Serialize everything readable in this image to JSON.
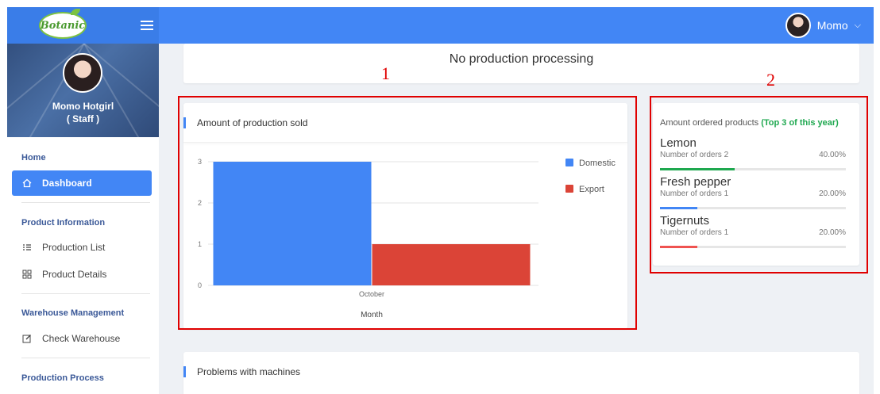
{
  "colors": {
    "topbar": "#4286f5",
    "accent": "#4286f5",
    "domestic": "#4286f5",
    "export": "#db4437",
    "green": "#1ea84f",
    "annotation_red": "#e00000"
  },
  "header": {
    "logo_text": "Botanic",
    "user_name": "Momo",
    "menu_icon": "hamburger-icon",
    "chevron_icon": "chevron-down-icon"
  },
  "sidebar": {
    "profile_name": "Momo Hotgirl",
    "profile_role": "( Staff )",
    "sections": [
      {
        "title": "Home",
        "items": [
          {
            "label": "Dashboard",
            "icon": "home-icon",
            "active": true
          }
        ]
      },
      {
        "title": "Product Information",
        "items": [
          {
            "label": "Production List",
            "icon": "list-icon"
          },
          {
            "label": "Product Details",
            "icon": "grid-icon"
          }
        ]
      },
      {
        "title": "Warehouse Management",
        "items": [
          {
            "label": "Check Warehouse",
            "icon": "edit-icon"
          }
        ]
      },
      {
        "title": "Production Process",
        "items": []
      }
    ]
  },
  "main": {
    "status": "No production processing",
    "annotations": [
      "1",
      "2"
    ],
    "chart_card_title": "Amount of production sold",
    "orders_card": {
      "title": "Amount ordered products",
      "highlight": "(Top 3 of this year)",
      "products": [
        {
          "name": "Lemon",
          "orders_label": "Number of orders 2",
          "percent_label": "40.00%",
          "percent": 40,
          "color": "#1ea84f"
        },
        {
          "name": "Fresh pepper",
          "orders_label": "Number of orders 1",
          "percent_label": "20.00%",
          "percent": 20,
          "color": "#4286f5"
        },
        {
          "name": "Tigernuts",
          "orders_label": "Number of orders 1",
          "percent_label": "20.00%",
          "percent": 20,
          "color": "#ef5350"
        }
      ]
    },
    "machines_card_title": "Problems with machines"
  },
  "chart_data": {
    "type": "bar",
    "categories": [
      "October"
    ],
    "series": [
      {
        "name": "Domestic",
        "values": [
          3
        ],
        "color": "#4286f5"
      },
      {
        "name": "Export",
        "values": [
          1
        ],
        "color": "#db4437"
      }
    ],
    "xlabel": "Month",
    "ylabel": "",
    "ylim": [
      0,
      3
    ],
    "yticks": [
      "0",
      "1",
      "2",
      "3"
    ],
    "grid": true,
    "legend": "right"
  }
}
